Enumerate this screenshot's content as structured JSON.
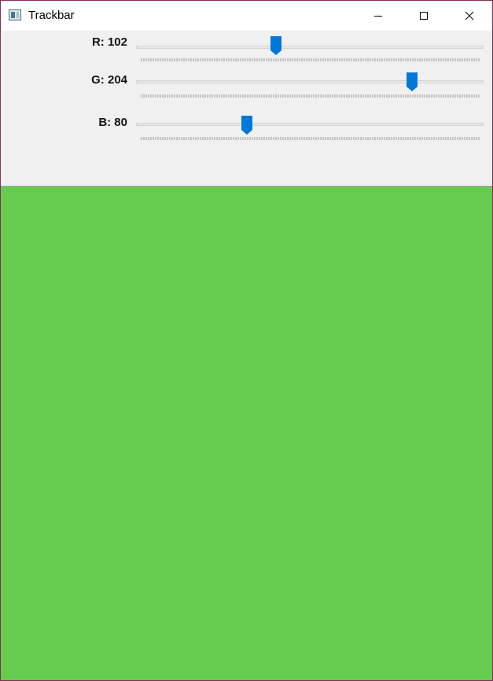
{
  "window": {
    "title": "Trackbar"
  },
  "sliders": [
    {
      "label": "R: 102",
      "value": 102,
      "max": 255
    },
    {
      "label": "G: 204",
      "value": 204,
      "max": 255
    },
    {
      "label": "B: 80",
      "value": 80,
      "max": 255
    }
  ],
  "colors": {
    "preview": "#66cc50",
    "thumb": "#0078d7",
    "window_border": "#8a2a5a"
  },
  "icons": {
    "app": "app-window-icon",
    "minimize": "minimize-icon",
    "maximize": "maximize-icon",
    "close": "close-icon"
  }
}
